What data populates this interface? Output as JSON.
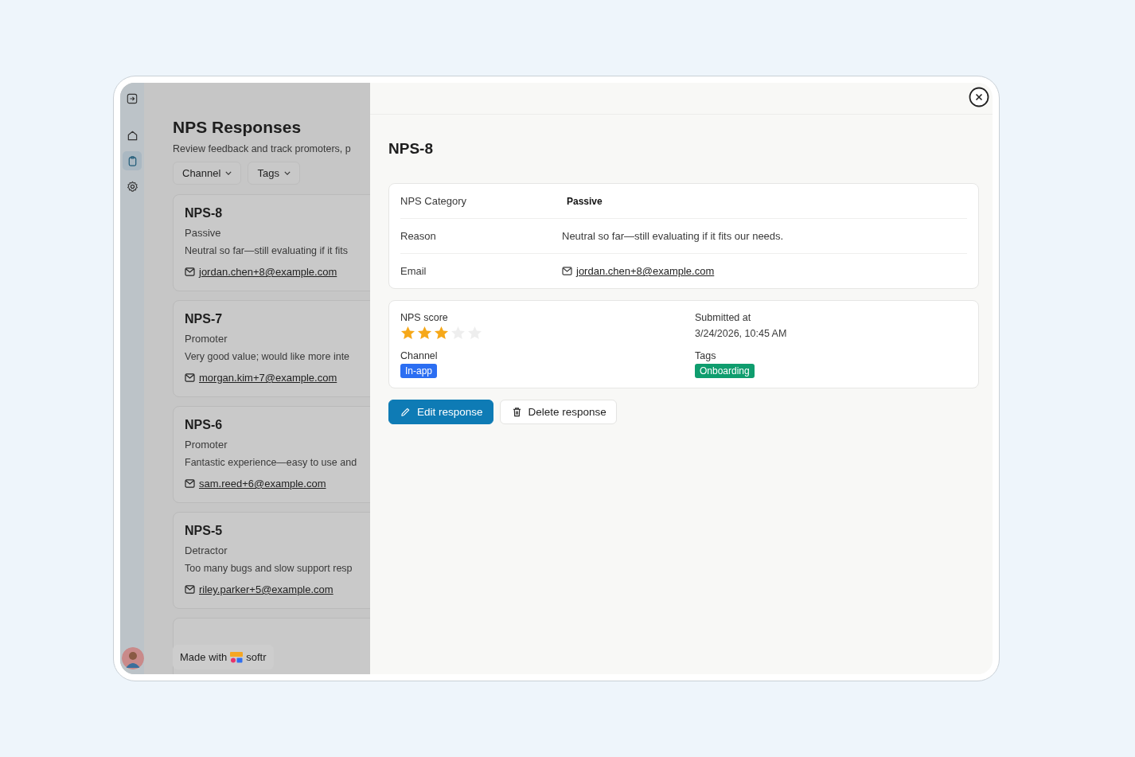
{
  "sidebar": {
    "nav_items": [
      {
        "kind": "home",
        "selected": false
      },
      {
        "kind": "clipboard",
        "selected": true
      },
      {
        "kind": "settings",
        "selected": false
      }
    ]
  },
  "page": {
    "title": "NPS Responses",
    "subtitle": "Review feedback and track promoters, p",
    "filters": [
      "Channel",
      "Tags"
    ]
  },
  "cards": [
    {
      "title": "NPS-8",
      "category": "Passive",
      "reason": "Neutral so far—still evaluating if it fits",
      "email": "jordan.chen+8@example.com"
    },
    {
      "title": "NPS-7",
      "category": "Promoter",
      "reason": "Very good value; would like more inte",
      "email": "morgan.kim+7@example.com"
    },
    {
      "title": "NPS-6",
      "category": "Promoter",
      "reason": "Fantastic experience—easy to use and",
      "email": "sam.reed+6@example.com"
    },
    {
      "title": "NPS-5",
      "category": "Detractor",
      "reason": "Too many bugs and slow support resp",
      "email": "riley.parker+5@example.com"
    }
  ],
  "badge": {
    "prefix": "Made with",
    "brand": "softr"
  },
  "drawer": {
    "title": "NPS-8",
    "details": [
      {
        "label": "NPS Category",
        "kind": "chip",
        "value": "Passive"
      },
      {
        "label": "Reason",
        "kind": "text",
        "value": "Neutral so far—still evaluating if it fits our needs."
      },
      {
        "label": "Email",
        "kind": "email",
        "value": "jordan.chen+8@example.com"
      }
    ],
    "score": {
      "label": "NPS score",
      "stars": 3
    },
    "submitted": {
      "label": "Submitted at",
      "value": "3/24/2026, 10:45 AM"
    },
    "channel": {
      "label": "Channel",
      "tag": "In-app",
      "color": "#2b6ef2"
    },
    "tags": {
      "label": "Tags",
      "tag": "Onboarding",
      "color": "#0f9d6e"
    },
    "buttons": [
      {
        "kind": "primary",
        "label": "Edit response"
      },
      {
        "kind": "secondary",
        "label": "Delete response"
      }
    ]
  }
}
